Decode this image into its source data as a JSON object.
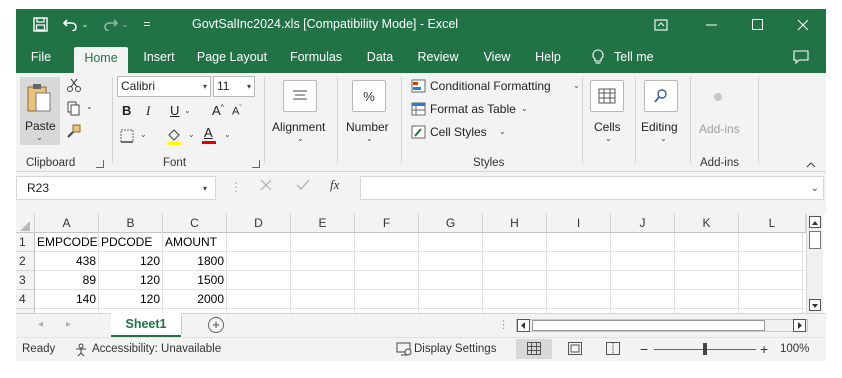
{
  "titlebar": {
    "title": "GovtSalInc2024.xls  [Compatibility Mode]  -  Excel",
    "qat_customize": "=",
    "icons": [
      "save-icon",
      "undo-icon",
      "redo-icon",
      "ribbon-display-icon",
      "minimize-icon",
      "maximize-icon",
      "close-icon"
    ]
  },
  "tabs": [
    "File",
    "Home",
    "Insert",
    "Page Layout",
    "Formulas",
    "Data",
    "Review",
    "View",
    "Help"
  ],
  "active_tab": "Home",
  "tell_me": "Tell me",
  "ribbon": {
    "clipboard": {
      "paste_label": "Paste",
      "group_label": "Clipboard"
    },
    "font": {
      "font_name": "Calibri",
      "font_size": "11",
      "bold": "B",
      "italic": "I",
      "underline": "U",
      "grow": "A",
      "shrink": "A",
      "color_a": "A",
      "group_label": "Font"
    },
    "alignment": {
      "label": "Alignment"
    },
    "number": {
      "label": "Number",
      "symbol": "%"
    },
    "styles": {
      "conditional": "Conditional Formatting",
      "format_table": "Format as Table",
      "cell_styles": "Cell Styles",
      "group_label": "Styles"
    },
    "cells": {
      "label": "Cells"
    },
    "editing": {
      "label": "Editing"
    },
    "addins": {
      "label": "Add-ins",
      "group_label": "Add-ins"
    }
  },
  "formula_bar": {
    "name_box": "R23",
    "fx": "fx",
    "formula": ""
  },
  "sheet": {
    "columns": [
      "A",
      "B",
      "C",
      "D",
      "E",
      "F",
      "G",
      "H",
      "I",
      "J",
      "K",
      "L"
    ],
    "rows": [
      {
        "num": "1",
        "cells": [
          "EMPCODE",
          "PDCODE",
          "AMOUNT"
        ]
      },
      {
        "num": "2",
        "cells": [
          "438",
          "120",
          "1800"
        ]
      },
      {
        "num": "3",
        "cells": [
          "89",
          "120",
          "1500"
        ]
      },
      {
        "num": "4",
        "cells": [
          "140",
          "120",
          "2000"
        ]
      }
    ]
  },
  "sheet_tabs": {
    "active": "Sheet1"
  },
  "status": {
    "ready": "Ready",
    "accessibility": "Accessibility: Unavailable",
    "display_settings": "Display Settings",
    "zoom": "100%",
    "zoom_fraction": 0.5
  },
  "colors": {
    "brand": "#217346",
    "ribbon_bg": "#f3f3f3",
    "grid": "#e1e1e1"
  }
}
